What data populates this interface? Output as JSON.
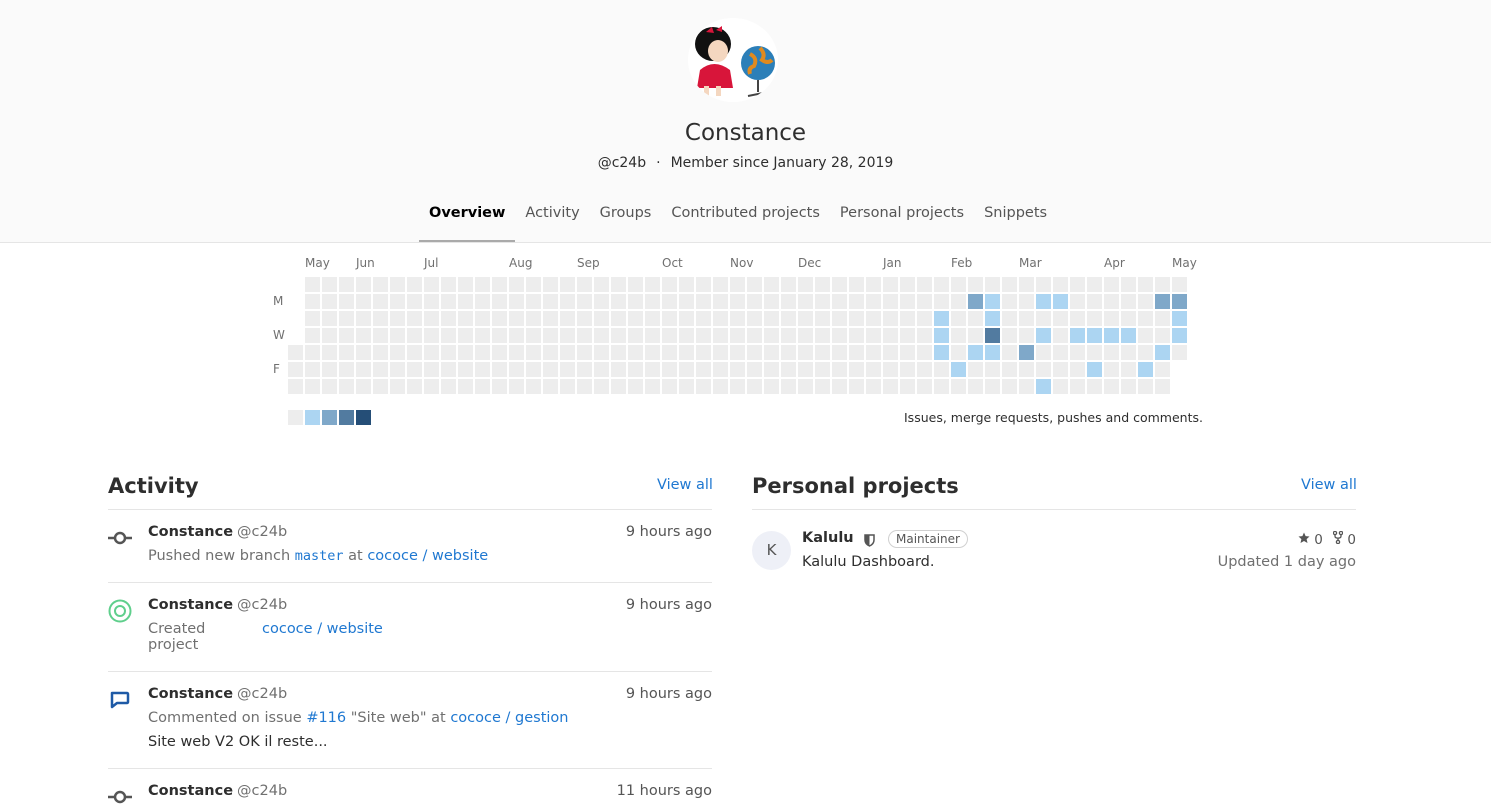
{
  "profile": {
    "name": "Constance",
    "handle": "@c24b",
    "separator": "·",
    "member_since": "Member since January 28, 2019"
  },
  "tabs": [
    "Overview",
    "Activity",
    "Groups",
    "Contributed projects",
    "Personal projects",
    "Snippets"
  ],
  "calendar": {
    "months": [
      {
        "label": "May",
        "col": 1
      },
      {
        "label": "Jun",
        "col": 4
      },
      {
        "label": "Jul",
        "col": 8
      },
      {
        "label": "Aug",
        "col": 13
      },
      {
        "label": "Sep",
        "col": 17
      },
      {
        "label": "Oct",
        "col": 22
      },
      {
        "label": "Nov",
        "col": 26
      },
      {
        "label": "Dec",
        "col": 30
      },
      {
        "label": "Jan",
        "col": 35
      },
      {
        "label": "Feb",
        "col": 39
      },
      {
        "label": "Mar",
        "col": 43
      },
      {
        "label": "Apr",
        "col": 48
      },
      {
        "label": "May",
        "col": 52
      }
    ],
    "day_labels": [
      {
        "label": "M",
        "row": 1
      },
      {
        "label": "W",
        "row": 3
      },
      {
        "label": "F",
        "row": 5
      }
    ],
    "colors": [
      "#ededed",
      "#acd5f2",
      "#7fa8c9",
      "#527ba0",
      "#254e77"
    ],
    "active_cells": [
      [
        38,
        2,
        1
      ],
      [
        38,
        3,
        1
      ],
      [
        38,
        4,
        1
      ],
      [
        39,
        5,
        1
      ],
      [
        40,
        1,
        2
      ],
      [
        40,
        4,
        1
      ],
      [
        41,
        1,
        1
      ],
      [
        41,
        2,
        1
      ],
      [
        41,
        3,
        3
      ],
      [
        41,
        4,
        1
      ],
      [
        43,
        4,
        2
      ],
      [
        44,
        1,
        1
      ],
      [
        44,
        3,
        1
      ],
      [
        44,
        6,
        1
      ],
      [
        45,
        1,
        1
      ],
      [
        46,
        3,
        1
      ],
      [
        47,
        3,
        1
      ],
      [
        47,
        5,
        1
      ],
      [
        48,
        3,
        1
      ],
      [
        49,
        3,
        1
      ],
      [
        50,
        5,
        1
      ],
      [
        51,
        1,
        2
      ],
      [
        51,
        4,
        1
      ],
      [
        52,
        1,
        2
      ],
      [
        52,
        2,
        1
      ],
      [
        52,
        3,
        1
      ]
    ],
    "description": "Issues, merge requests, pushes and comments."
  },
  "activity": {
    "title": "Activity",
    "view_all": "View all",
    "events": [
      {
        "author": "Constance",
        "handle": "@c24b",
        "time": "9 hours ago",
        "action": "Pushed new branch",
        "ref": "master",
        "at": "at",
        "target": "cococe / website"
      },
      {
        "author": "Constance",
        "handle": "@c24b",
        "time": "9 hours ago",
        "action": "Created",
        "action2": "project",
        "target": "cococe / website"
      },
      {
        "author": "Constance",
        "handle": "@c24b",
        "time": "9 hours ago",
        "action": "Commented on",
        "kind": "issue",
        "issue": "#116",
        "issue_title": "\"Site web\"",
        "at": "at",
        "target": "cococe / gestion",
        "note": "Site web V2 OK il reste..."
      },
      {
        "author": "Constance",
        "handle": "@c24b",
        "time": "11 hours ago"
      }
    ]
  },
  "projects": {
    "title": "Personal projects",
    "view_all": "View all",
    "items": [
      {
        "initial": "K",
        "name": "Kalulu",
        "role": "Maintainer",
        "description": "Kalulu Dashboard.",
        "stars": "0",
        "forks": "0",
        "updated": "Updated 1 day ago"
      }
    ]
  }
}
